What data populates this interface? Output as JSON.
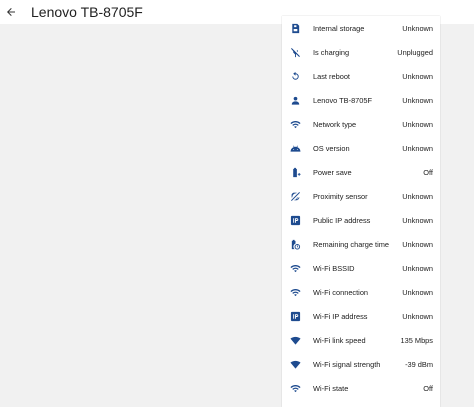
{
  "header": {
    "back_icon": "arrow-back-icon",
    "title": "Lenovo TB-8705F"
  },
  "colors": {
    "icon": "#1e4b8f",
    "background": "#f1f1f1",
    "card": "#ffffff"
  },
  "rows": [
    {
      "icon": "storage-icon",
      "label": "Internal storage",
      "value": "Unknown"
    },
    {
      "icon": "charging-off-icon",
      "label": "Is charging",
      "value": "Unplugged"
    },
    {
      "icon": "restart-icon",
      "label": "Last reboot",
      "value": "Unknown"
    },
    {
      "icon": "person-icon",
      "label": "Lenovo TB-8705F",
      "value": "Unknown"
    },
    {
      "icon": "wifi-icon",
      "label": "Network type",
      "value": "Unknown"
    },
    {
      "icon": "android-icon",
      "label": "OS version",
      "value": "Unknown"
    },
    {
      "icon": "battery-plus-icon",
      "label": "Power save",
      "value": "Off"
    },
    {
      "icon": "proximity-icon",
      "label": "Proximity sensor",
      "value": "Unknown"
    },
    {
      "icon": "ip-icon",
      "label": "Public IP address",
      "value": "Unknown"
    },
    {
      "icon": "battery-clock-icon",
      "label": "Remaining charge time",
      "value": "Unknown"
    },
    {
      "icon": "wifi-icon",
      "label": "Wi-Fi BSSID",
      "value": "Unknown"
    },
    {
      "icon": "wifi-icon",
      "label": "Wi-Fi connection",
      "value": "Unknown"
    },
    {
      "icon": "ip-icon",
      "label": "Wi-Fi IP address",
      "value": "Unknown"
    },
    {
      "icon": "wifi-strength-icon",
      "label": "Wi-Fi link speed",
      "value": "135 Mbps"
    },
    {
      "icon": "wifi-strength-icon",
      "label": "Wi-Fi signal strength",
      "value": "-39 dBm"
    },
    {
      "icon": "wifi-icon",
      "label": "Wi-Fi state",
      "value": "Off"
    }
  ]
}
